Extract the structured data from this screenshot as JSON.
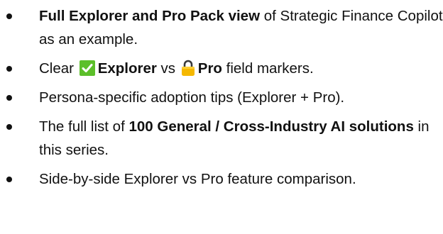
{
  "bullets": [
    {
      "b1_bold": "Full Explorer and  Pro Pack view",
      "b1_rest": " of Strategic Finance Copilot as an example."
    },
    {
      "clear": "Clear ",
      "explorer_icon": "green-check-icon",
      "explorer": "Explorer",
      "vs": " vs ",
      "pro_icon": "lock-icon",
      "pro": "Pro",
      "rest": " field markers."
    },
    {
      "text": "Persona-specific adoption tips (Explorer + Pro)."
    },
    {
      "pre": "The full list of ",
      "bold": "100 General / Cross-Industry AI solutions",
      "rest": " in this series."
    },
    {
      "text": "Side-by-side Explorer vs Pro feature comparison."
    }
  ],
  "colors": {
    "check_bg": "#5cbf2a",
    "lock_body": "#f5b800",
    "lock_shackle": "#3a3a3a",
    "text": "#111111"
  }
}
